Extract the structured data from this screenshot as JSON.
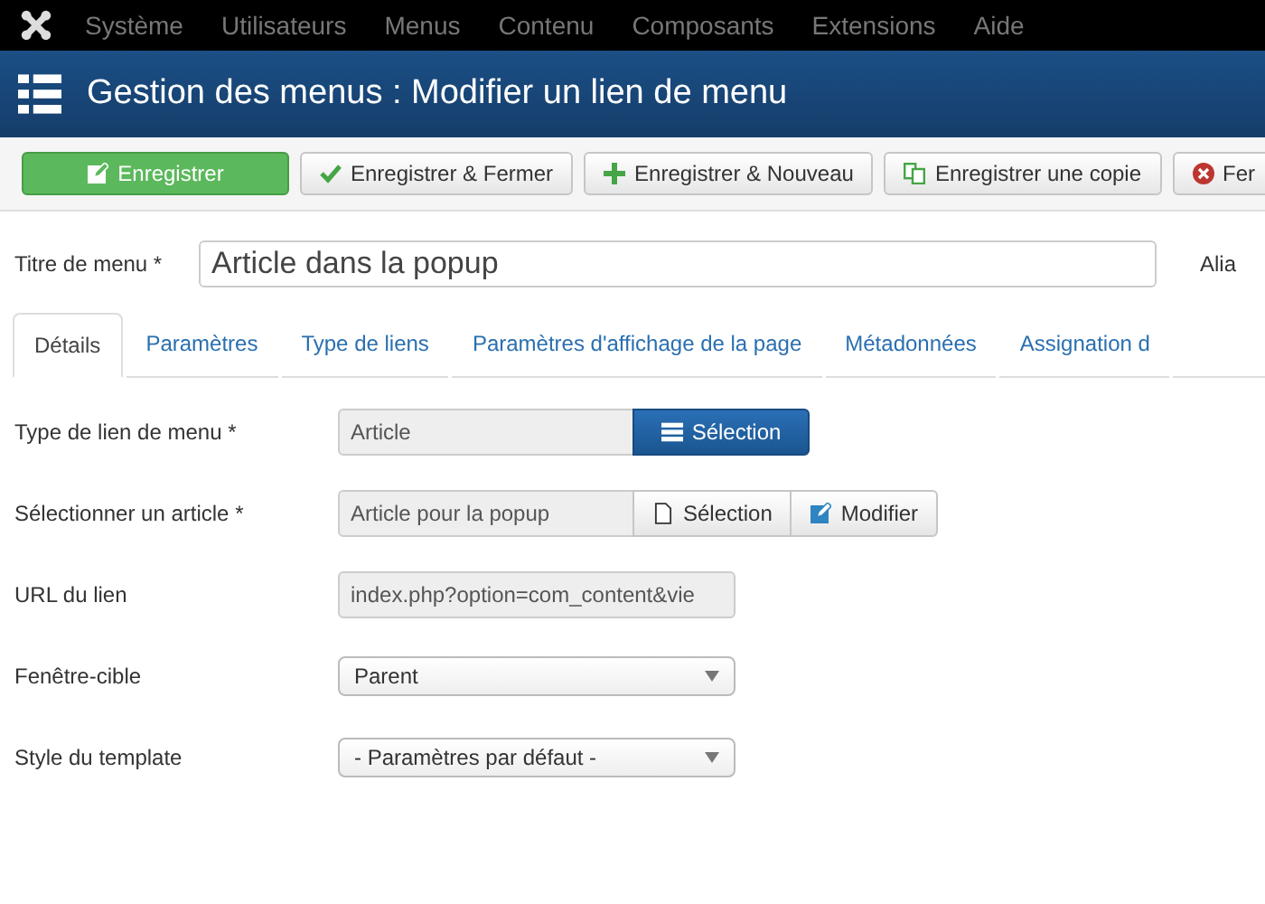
{
  "menubar": {
    "items": [
      "Système",
      "Utilisateurs",
      "Menus",
      "Contenu",
      "Composants",
      "Extensions",
      "Aide"
    ]
  },
  "header": {
    "title": "Gestion des menus : Modifier un lien de menu"
  },
  "toolbar": [
    {
      "kind": "save",
      "label": "Enregistrer"
    },
    {
      "kind": "save-close",
      "label": "Enregistrer & Fermer"
    },
    {
      "kind": "save-new",
      "label": "Enregistrer & Nouveau"
    },
    {
      "kind": "save-copy",
      "label": "Enregistrer une copie"
    },
    {
      "kind": "close",
      "label": "Fer"
    }
  ],
  "title_field": {
    "label": "Titre de menu *",
    "value": "Article dans la popup",
    "alias_label": "Alia"
  },
  "tabs": [
    {
      "label": "Détails",
      "selected": true
    },
    {
      "label": "Paramètres",
      "selected": false
    },
    {
      "label": "Type de liens",
      "selected": false
    },
    {
      "label": "Paramètres d'affichage de la page",
      "selected": false
    },
    {
      "label": "Métadonnées",
      "selected": false
    },
    {
      "label": "Assignation d",
      "selected": false
    }
  ],
  "fields": [
    {
      "kind": "readonly",
      "label": "Type de lien de menu *",
      "value": "Article",
      "buttons": [
        {
          "kind": "primary-list",
          "label": "Sélection"
        }
      ]
    },
    {
      "kind": "readonly",
      "label": "Sélectionner un article *",
      "value": "Article pour la popup",
      "buttons": [
        {
          "kind": "file",
          "label": "Sélection"
        },
        {
          "kind": "edit",
          "label": "Modifier"
        }
      ]
    },
    {
      "kind": "readonly",
      "label": "URL du lien",
      "value": "index.php?option=com_content&vie"
    },
    {
      "kind": "select",
      "label": "Fenêtre-cible",
      "value": "Parent"
    },
    {
      "kind": "select",
      "label": "Style du template",
      "value": "- Paramètres par défaut -"
    }
  ]
}
